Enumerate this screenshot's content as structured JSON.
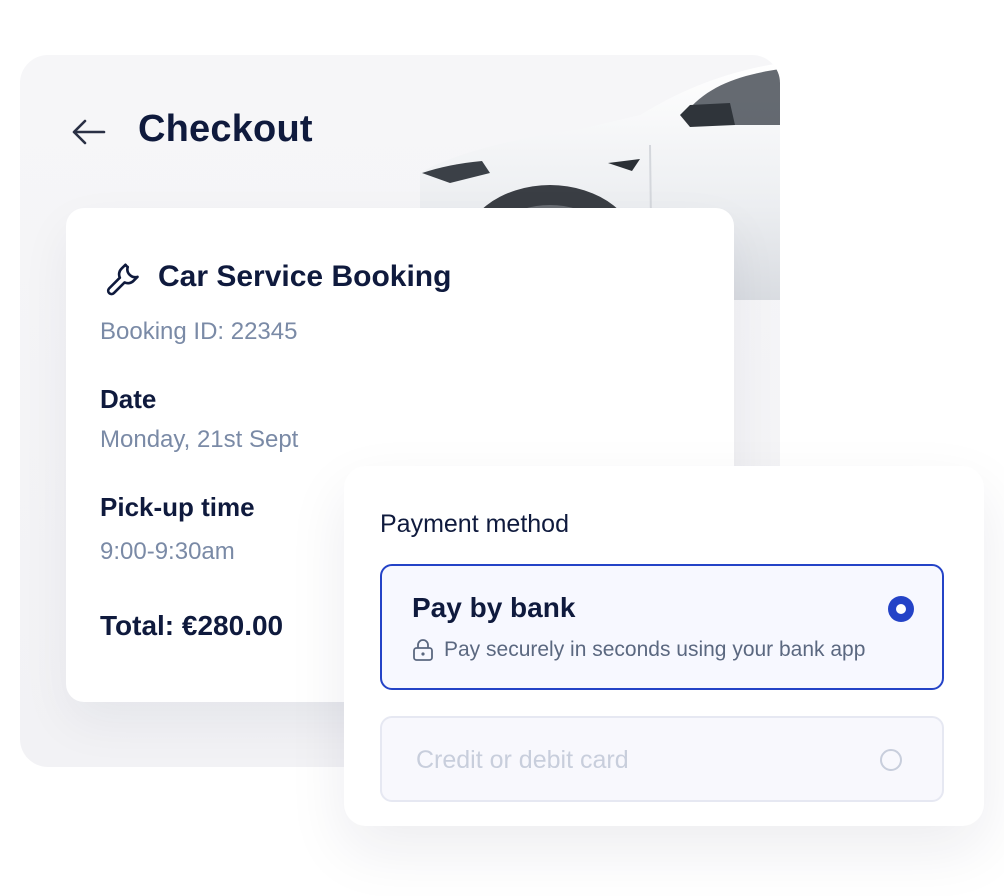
{
  "header": {
    "title": "Checkout",
    "back_icon": "arrow-left-icon"
  },
  "booking": {
    "icon": "wrench-icon",
    "title": "Car Service Booking",
    "booking_id": "Booking ID: 22345",
    "date_label": "Date",
    "date_value": "Monday, 21st Sept",
    "pickup_label": "Pick-up time",
    "pickup_value": "9:00-9:30am",
    "total": "Total: €280.00"
  },
  "payment": {
    "heading": "Payment method",
    "options": [
      {
        "title": "Pay by bank",
        "subtitle": "Pay securely in seconds using your bank app",
        "icon": "lock-icon",
        "selected": true
      },
      {
        "title": "Credit or debit card",
        "selected": false
      }
    ]
  },
  "colors": {
    "primary": "#2443c7",
    "text_dark": "#0f1a3d",
    "text_muted": "#7a8aa6",
    "disabled": "#c8cedc"
  }
}
